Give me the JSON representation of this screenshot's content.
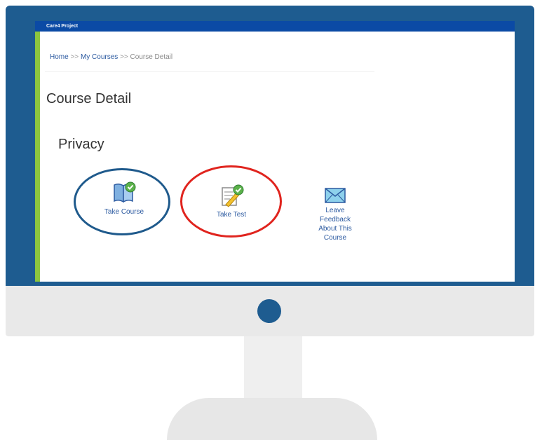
{
  "app": {
    "title": "Care4 Project"
  },
  "breadcrumb": {
    "home": "Home",
    "separator_1": ">>",
    "my_courses": "My Courses",
    "separator_2": ">>",
    "current": "Course Detail"
  },
  "page": {
    "title": "Course Detail",
    "course_name": "Privacy"
  },
  "actions": {
    "take_course": {
      "label": "Take Course",
      "icon": "book-check-icon"
    },
    "take_test": {
      "label": "Take Test",
      "icon": "test-pencil-icon"
    },
    "feedback": {
      "label_lines": [
        "Leave",
        "Feedback",
        "About This",
        "Course"
      ],
      "icon": "envelope-icon"
    }
  },
  "colors": {
    "frame": "#1e5c90",
    "title_bar": "#0b4aa5",
    "accent": "#8dc63f",
    "link": "#2c5aa0",
    "highlight_blue": "#1f5a8c",
    "highlight_red": "#e0241e"
  }
}
